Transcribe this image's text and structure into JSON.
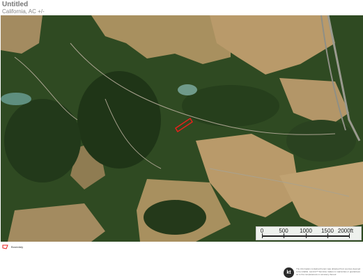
{
  "header": {
    "title": "Untitled",
    "subtitle": "California, AC +/-"
  },
  "scale_bar": {
    "ticks": [
      "0",
      "500",
      "1000",
      "1500",
      "2000ft"
    ]
  },
  "legend": {
    "label": "Boundary",
    "color": "#e8201c"
  },
  "footer": {
    "logo": "kt",
    "disclaimer": "The information contained herein was obtained from sources deemed to be reliable. Land.id™ Services makes no warranties or guarantees as to the completeness or accuracy thereof."
  },
  "colors": {
    "boundary": "#e8201c",
    "forest": "#2f4a22",
    "grass": "#b99a6a",
    "water": "#5f8f7f"
  }
}
